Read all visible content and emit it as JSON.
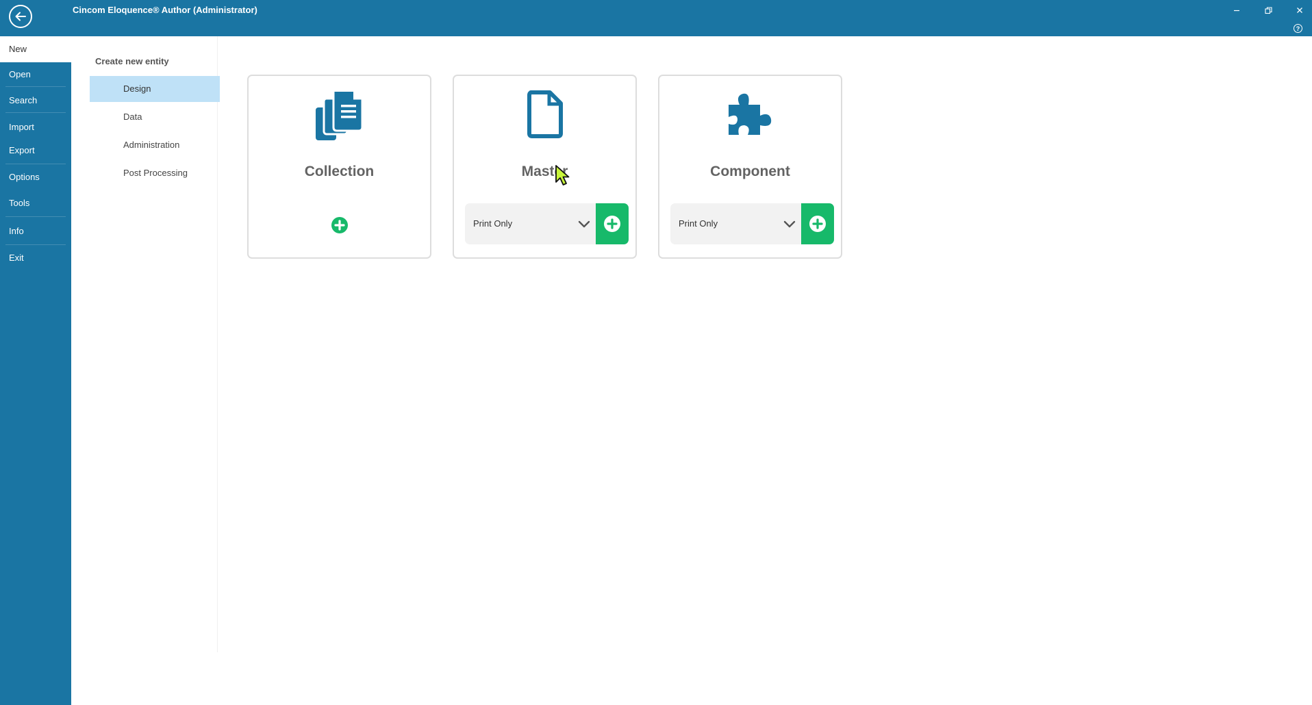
{
  "window": {
    "title": "Cincom Eloquence® Author (Administrator)",
    "help_label": "?"
  },
  "colors": {
    "brand": "#1a75a3",
    "selected_category": "#bfe1f7",
    "add_green": "#17b96a"
  },
  "nav": {
    "items": [
      {
        "label": "New",
        "active": true
      },
      {
        "label": "Open"
      },
      {
        "label": "Search"
      },
      {
        "label": "Import"
      },
      {
        "label": "Export"
      },
      {
        "label": "Options"
      },
      {
        "label": "Tools"
      },
      {
        "label": "Info"
      },
      {
        "label": "Exit"
      }
    ]
  },
  "categories": {
    "header": "Create new entity",
    "items": [
      {
        "label": "Design",
        "selected": true
      },
      {
        "label": "Data"
      },
      {
        "label": "Administration"
      },
      {
        "label": "Post Processing"
      }
    ]
  },
  "cards": [
    {
      "title": "Collection",
      "icon": "documents-stack-icon"
    },
    {
      "title": "Master",
      "icon": "document-icon",
      "dropdown_value": "Print Only"
    },
    {
      "title": "Component",
      "icon": "puzzle-piece-icon",
      "dropdown_value": "Print Only"
    }
  ]
}
